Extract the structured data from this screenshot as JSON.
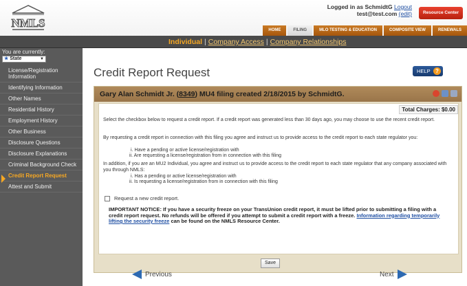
{
  "header": {
    "logo_text": "NMLS",
    "login_prefix": "Logged in as SchmidtG",
    "logout_label": "Logout",
    "email": "test@test.com",
    "edit_label": "(edit)",
    "resource_center_label": "Resource Center",
    "nav_tabs": [
      "HOME",
      "FILING",
      "MLO TESTING & EDUCATION",
      "COMPOSITE VIEW",
      "RENEWALS"
    ],
    "active_tab": "FILING"
  },
  "subnav": {
    "individual": "Individual",
    "company_access": "Company Access",
    "company_relationships": "Company Relationships",
    "separator": "|"
  },
  "sidebar": {
    "you_are_currently": "You are currently:",
    "state_value": "State",
    "items": [
      "License/Registration Information",
      "Identifying Information",
      "Other Names",
      "Residential History",
      "Employment History",
      "Other Business",
      "Disclosure Questions",
      "Disclosure Explanations",
      "Criminal Background Check",
      "Credit Report Request",
      "Attest and Submit"
    ],
    "current_index": 9
  },
  "main": {
    "title": "Credit Report Request",
    "help_label": "HELP",
    "help_icon": "?",
    "panel_title_prefix": "Gary Alan Schmidt Jr. (",
    "panel_id": "8349",
    "panel_title_suffix": ") MU4 filing created 2/18/2015 by SchmidtG.",
    "total_charges": "Total Charges: $0.00",
    "para1": "Select the checkbox below to request a credit report. If a credit report was generated less than 30 days ago, you may choose to use the recent credit report.",
    "para2": "By requesting a credit report in connection with this filing you agree and instruct us to provide access to the credit report to each state regulator you:",
    "para2_items": [
      "i. Have a pending or active license/registration with",
      "ii. Are requesting a license/registration from in connection with this filing"
    ],
    "para3": "In addition, if you are an MU2 Individual, you agree and instruct us to provide access to the credit report to each state regulator that any company associated with you through NMLS:",
    "para3_items": [
      "i. Has a pending or active license/registration with",
      "ii. Is requesting a license/registration from in connection with this filing"
    ],
    "checkbox_label": "Request a new credit report.",
    "notice_text": "IMPORTANT NOTICE: If you have a security freeze on your TransUnion credit report, it must be lifted prior to submitting a filing with a credit report request. No refunds will be offered if you attempt to submit a credit report with a freeze.",
    "notice_link": "Information regarding temporarily lifting the security freeze",
    "notice_tail": "can be found on the NMLS Resource Center.",
    "save_label": "Save",
    "previous_label": "Previous",
    "next_label": "Next"
  },
  "colors": {
    "accent_orange": "#f7a823",
    "panel_header": "#a88352",
    "panel_bg": "#e7dfc8",
    "sidebar_bg": "#5a5a5a",
    "nav_arrow_blue": "#2e6ab2"
  }
}
